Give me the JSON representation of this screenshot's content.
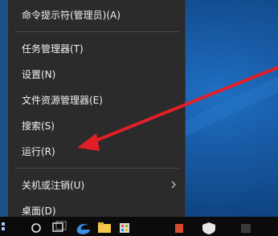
{
  "menu": {
    "items": [
      {
        "label": "命令提示符(管理员)(A)",
        "name": "menu-item-command-prompt-admin"
      },
      {
        "label": "任务管理器(T)",
        "name": "menu-item-task-manager"
      },
      {
        "label": "设置(N)",
        "name": "menu-item-settings"
      },
      {
        "label": "文件资源管理器(E)",
        "name": "menu-item-file-explorer"
      },
      {
        "label": "搜索(S)",
        "name": "menu-item-search"
      },
      {
        "label": "运行(R)",
        "name": "menu-item-run"
      },
      {
        "label": "关机或注销(U)",
        "name": "menu-item-shutdown-signout",
        "has_submenu": true
      },
      {
        "label": "桌面(D)",
        "name": "menu-item-desktop"
      }
    ]
  },
  "annotation": {
    "arrow_color": "#e21f26",
    "arrow_icon": "red-arrow-pointing-to-run"
  },
  "taskbar": {
    "icons": [
      "start-icon",
      "search-icon",
      "task-view-icon",
      "edge-icon",
      "file-explorer-icon",
      "store-icon",
      "app-icon",
      "defender-icon"
    ]
  },
  "colors": {
    "menu_bg": "#2b2b2b",
    "menu_text": "#f2f2f2",
    "separator": "#4a4a4a",
    "desktop_blue": "#16569e",
    "taskbar": "#0b0b0b"
  }
}
